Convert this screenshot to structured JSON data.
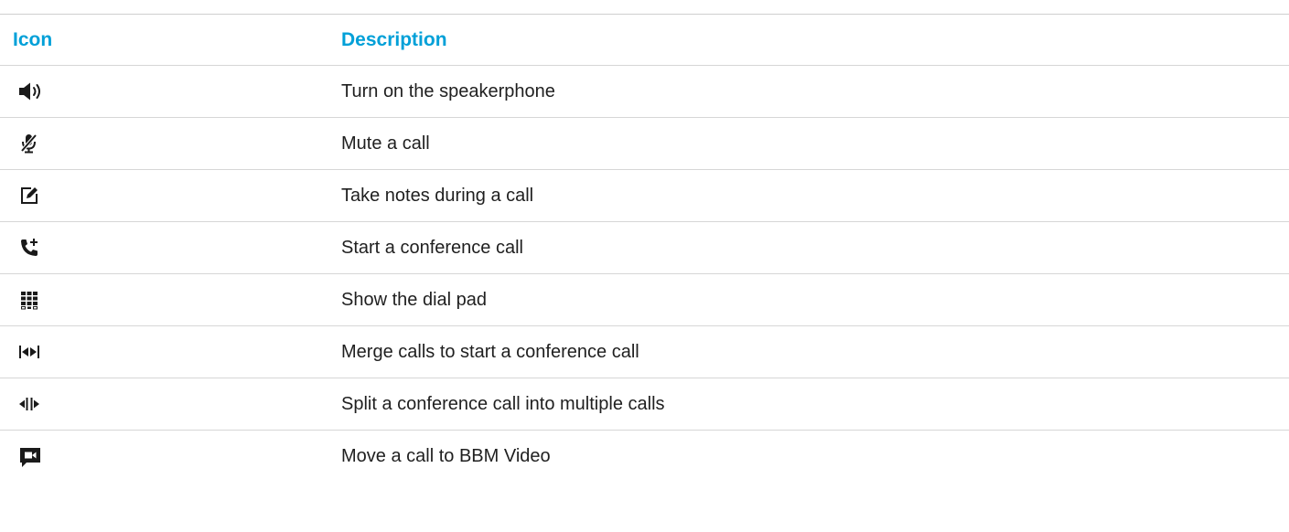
{
  "table": {
    "headers": {
      "icon": "Icon",
      "description": "Description"
    },
    "rows": [
      {
        "icon": "speaker-icon",
        "description": "Turn on the speakerphone"
      },
      {
        "icon": "mute-microphone-icon",
        "description": "Mute a call"
      },
      {
        "icon": "notes-edit-icon",
        "description": "Take notes during a call"
      },
      {
        "icon": "add-call-icon",
        "description": "Start a conference call"
      },
      {
        "icon": "dial-pad-icon",
        "description": "Show the dial pad"
      },
      {
        "icon": "merge-calls-icon",
        "description": "Merge calls to start a conference call"
      },
      {
        "icon": "split-calls-icon",
        "description": "Split a conference call into multiple calls"
      },
      {
        "icon": "video-chat-icon",
        "description": "Move a call to BBM Video"
      }
    ]
  },
  "colors": {
    "header_text": "#00a0d8",
    "body_text": "#1f1f1f",
    "rule": "#d6d6d6",
    "icon": "#1a1a1a"
  }
}
